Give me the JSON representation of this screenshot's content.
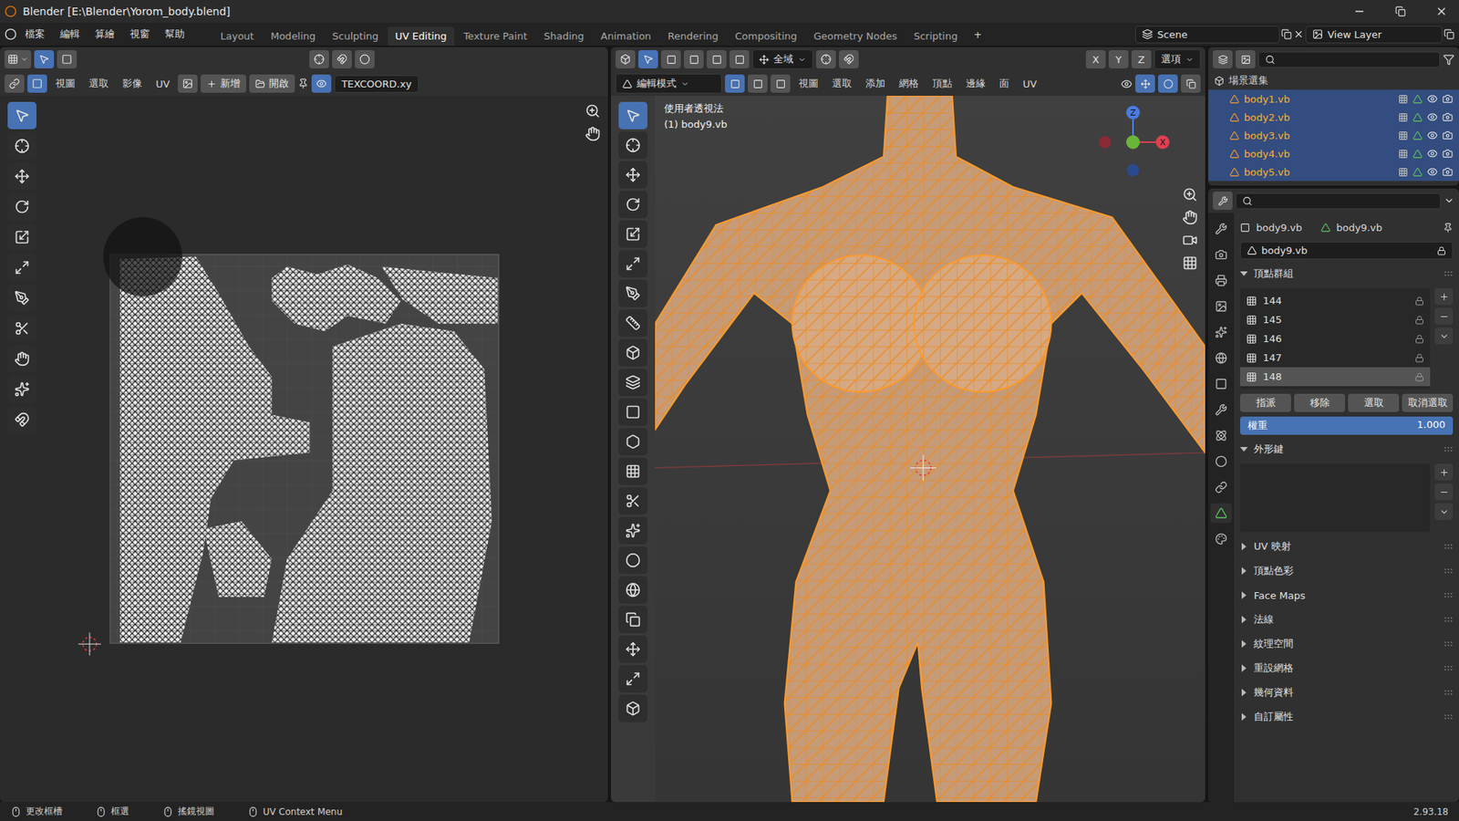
{
  "window": {
    "title": "Blender [E:\\Blender\\Yorom_body.blend]"
  },
  "menu": [
    "檔案",
    "編輯",
    "算繪",
    "視窗",
    "幫助"
  ],
  "workspaces": [
    {
      "label": "Layout",
      "selected": false
    },
    {
      "label": "Modeling",
      "selected": false
    },
    {
      "label": "Sculpting",
      "selected": false
    },
    {
      "label": "UV Editing",
      "selected": true
    },
    {
      "label": "Texture Paint",
      "selected": false
    },
    {
      "label": "Shading",
      "selected": false
    },
    {
      "label": "Animation",
      "selected": false
    },
    {
      "label": "Rendering",
      "selected": false
    },
    {
      "label": "Compositing",
      "selected": false
    },
    {
      "label": "Geometry Nodes",
      "selected": false
    },
    {
      "label": "Scripting",
      "selected": false
    }
  ],
  "add_workspace": "+",
  "scene": "Scene",
  "view_layer": "View Layer",
  "uv_editor": {
    "header_menus": [
      "視圖",
      "選取",
      "影像",
      "UV"
    ],
    "new_button": "新增",
    "open_button": "開啟",
    "image_name": "TEXCOORD.xy",
    "tools": [
      {
        "selected": true
      },
      {
        "selected": false
      },
      {
        "selected": false
      },
      {
        "selected": false
      },
      {
        "selected": false
      },
      {
        "selected": false
      },
      {
        "selected": false
      },
      {
        "selected": false
      },
      {
        "selected": false
      },
      {
        "selected": false
      },
      {
        "selected": false
      }
    ]
  },
  "viewport": {
    "mode": "編輯模式",
    "header_menus": [
      "視圖",
      "選取",
      "添加",
      "網格",
      "頂點",
      "邊緣",
      "面",
      "UV"
    ],
    "transform_orientation": "全域",
    "options": "選項",
    "axes_buttons": [
      "X",
      "Y",
      "Z"
    ],
    "select_modes": [
      {
        "selected": true
      },
      {
        "selected": false
      },
      {
        "selected": false
      }
    ],
    "overlay_title": "使用者透視法",
    "overlay_object": "(1) body9.vb",
    "gizmo": [
      "Z",
      "X"
    ],
    "tools": [
      {
        "selected": true
      },
      {
        "selected": false
      },
      {
        "selected": false
      },
      {
        "selected": false
      },
      {
        "selected": false
      },
      {
        "selected": false
      },
      {
        "selected": false
      },
      {
        "selected": false
      },
      {
        "selected": false
      },
      {
        "selected": false
      },
      {
        "selected": false
      },
      {
        "selected": false
      },
      {
        "selected": false
      },
      {
        "selected": false
      },
      {
        "selected": false
      },
      {
        "selected": false
      },
      {
        "selected": false
      },
      {
        "selected": false
      },
      {
        "selected": false
      },
      {
        "selected": false
      },
      {
        "selected": false
      }
    ]
  },
  "outliner": {
    "root": "場景選集",
    "items": [
      {
        "name": "body1.vb",
        "selected": true
      },
      {
        "name": "body2.vb",
        "selected": true
      },
      {
        "name": "body3.vb",
        "selected": true
      },
      {
        "name": "body4.vb",
        "selected": true
      },
      {
        "name": "body5.vb",
        "selected": true
      }
    ]
  },
  "properties": {
    "tabs": [
      {
        "selected": false
      },
      {
        "selected": false
      },
      {
        "selected": false
      },
      {
        "selected": false
      },
      {
        "selected": false
      },
      {
        "selected": false
      },
      {
        "selected": false
      },
      {
        "selected": false
      },
      {
        "selected": false
      },
      {
        "selected": false
      },
      {
        "selected": false
      },
      {
        "selected": true
      },
      {
        "selected": false
      }
    ],
    "object_name": "body9.vb",
    "mesh_name": "body9.vb",
    "data_name": "body9.vb",
    "vertex_groups": {
      "title": "頂點群組",
      "expanded": true,
      "items": [
        {
          "name": "144",
          "selected": false
        },
        {
          "name": "145",
          "selected": false
        },
        {
          "name": "146",
          "selected": false
        },
        {
          "name": "147",
          "selected": false
        },
        {
          "name": "148",
          "selected": true
        }
      ],
      "buttons": [
        "指派",
        "移除",
        "選取",
        "取消選取"
      ],
      "weight": {
        "label": "權重",
        "level": 1,
        "reading": "1.000"
      }
    },
    "shape_keys": {
      "title": "外形鍵",
      "expanded": true
    },
    "panels": [
      {
        "title": "UV 映射",
        "expanded": false
      },
      {
        "title": "頂點色彩",
        "expanded": false
      },
      {
        "title": "Face Maps",
        "expanded": false
      },
      {
        "title": "法線",
        "expanded": false
      },
      {
        "title": "紋理空間",
        "expanded": false
      },
      {
        "title": "重設網格",
        "expanded": false
      },
      {
        "title": "幾何資料",
        "expanded": false
      },
      {
        "title": "自訂屬性",
        "expanded": false
      }
    ]
  },
  "status_bar": {
    "items": [
      "更改框槽",
      "框選",
      "搖鏡視圖",
      "UV Context Menu"
    ],
    "version": "2.93.18"
  }
}
